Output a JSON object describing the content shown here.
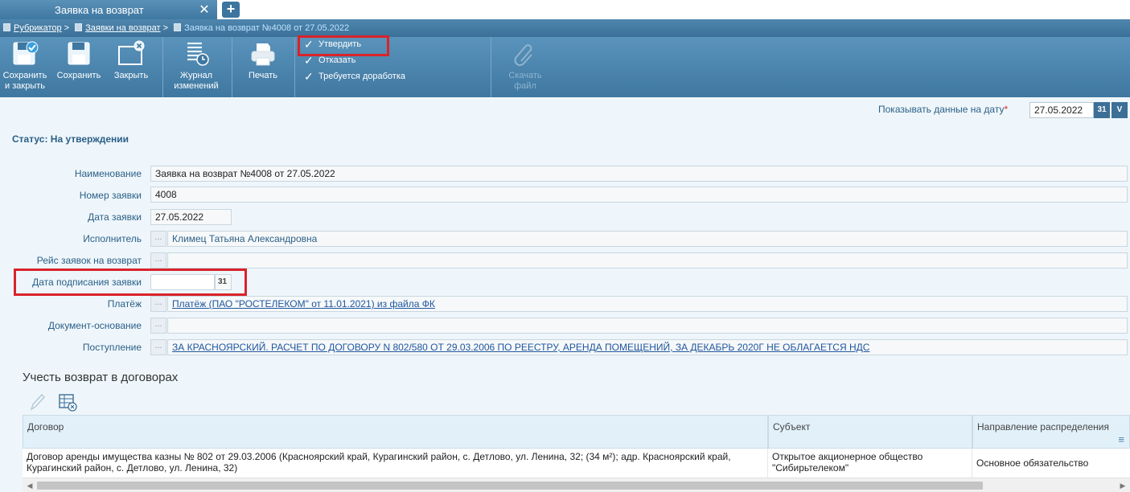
{
  "tabs": {
    "active_label": "Заявка на возврат",
    "close_glyph": "✕",
    "add_glyph": "+"
  },
  "breadcrumb": {
    "items": [
      "Рубрикатор",
      "Заявки на возврат",
      "Заявка на возврат №4008 от 27.05.2022"
    ],
    "separator": ">"
  },
  "toolbar": {
    "save_close": [
      "Сохранить",
      "и закрыть"
    ],
    "save": "Сохранить",
    "close": "Закрыть",
    "journal": [
      "Журнал",
      "изменений"
    ],
    "print": "Печать",
    "actions": [
      "Утвердить",
      "Отказать",
      "Требуется доработка"
    ],
    "download": [
      "Скачать",
      "файл"
    ],
    "icons": [
      "save-close-icon",
      "save-icon",
      "close-window-icon",
      "journal-icon",
      "printer-icon",
      "check-icon",
      "paperclip-icon"
    ]
  },
  "date_filter": {
    "label": "Показывать данные на дату",
    "required_mark": "*",
    "value": "27.05.2022",
    "cal_glyph": "31",
    "dropdown_glyph": "V"
  },
  "status": "Статус: На утверждении",
  "form": {
    "name_label": "Наименование",
    "name_value": "Заявка на возврат №4008 от 27.05.2022",
    "number_label": "Номер заявки",
    "number_value": "4008",
    "date_label": "Дата заявки",
    "date_value": "27.05.2022",
    "executor_label": "Исполнитель",
    "executor_value": "Климец Татьяна Александровна",
    "flight_label": "Рейс заявок на возврат",
    "flight_value": "",
    "sign_date_label": "Дата подписания заявки",
    "sign_date_value": "",
    "payment_label": "Платёж",
    "payment_value": "Платёж (ПАО \"РОСТЕЛЕКОМ\" от 11.01.2021) из файла ФК",
    "basis_label": "Документ-основание",
    "basis_value": "",
    "receipt_label": "Поступление",
    "receipt_value": "ЗА КРАСНОЯРСКИЙ. РАСЧЕТ ПО ДОГОВОРУ N 802/580 ОТ 29.03.2006 ПО РЕЕСТРУ, АРЕНДА ПОМЕЩЕНИЙ, ЗА ДЕКАБРЬ 2020Г НЕ ОБЛАГАЕТСЯ НДС",
    "dots_glyph": "..."
  },
  "section": {
    "title": "Учесть возврат в договорах"
  },
  "table": {
    "columns": [
      "Договор",
      "Субъект",
      "Направление распределения"
    ],
    "rows": [
      {
        "contract": "Договор аренды имущества казны № 802 от 29.03.2006 (Красноярский край, Курагинский район, с. Детлово, ул. Ленина, 32; (34 м²); адр. Красноярский край, Курагинский район, с. Детлово, ул. Ленина, 32)",
        "subject": "Открытое акционерное общество \"Сибирьтелеком\"",
        "direction": "Основное обязательство"
      }
    ],
    "menu_glyph": "≡"
  },
  "colors": {
    "toolbar_bg": "#4a84ad",
    "highlight": "#d9232a",
    "label_blue": "#2b5f86",
    "link_blue": "#1f57a0"
  }
}
